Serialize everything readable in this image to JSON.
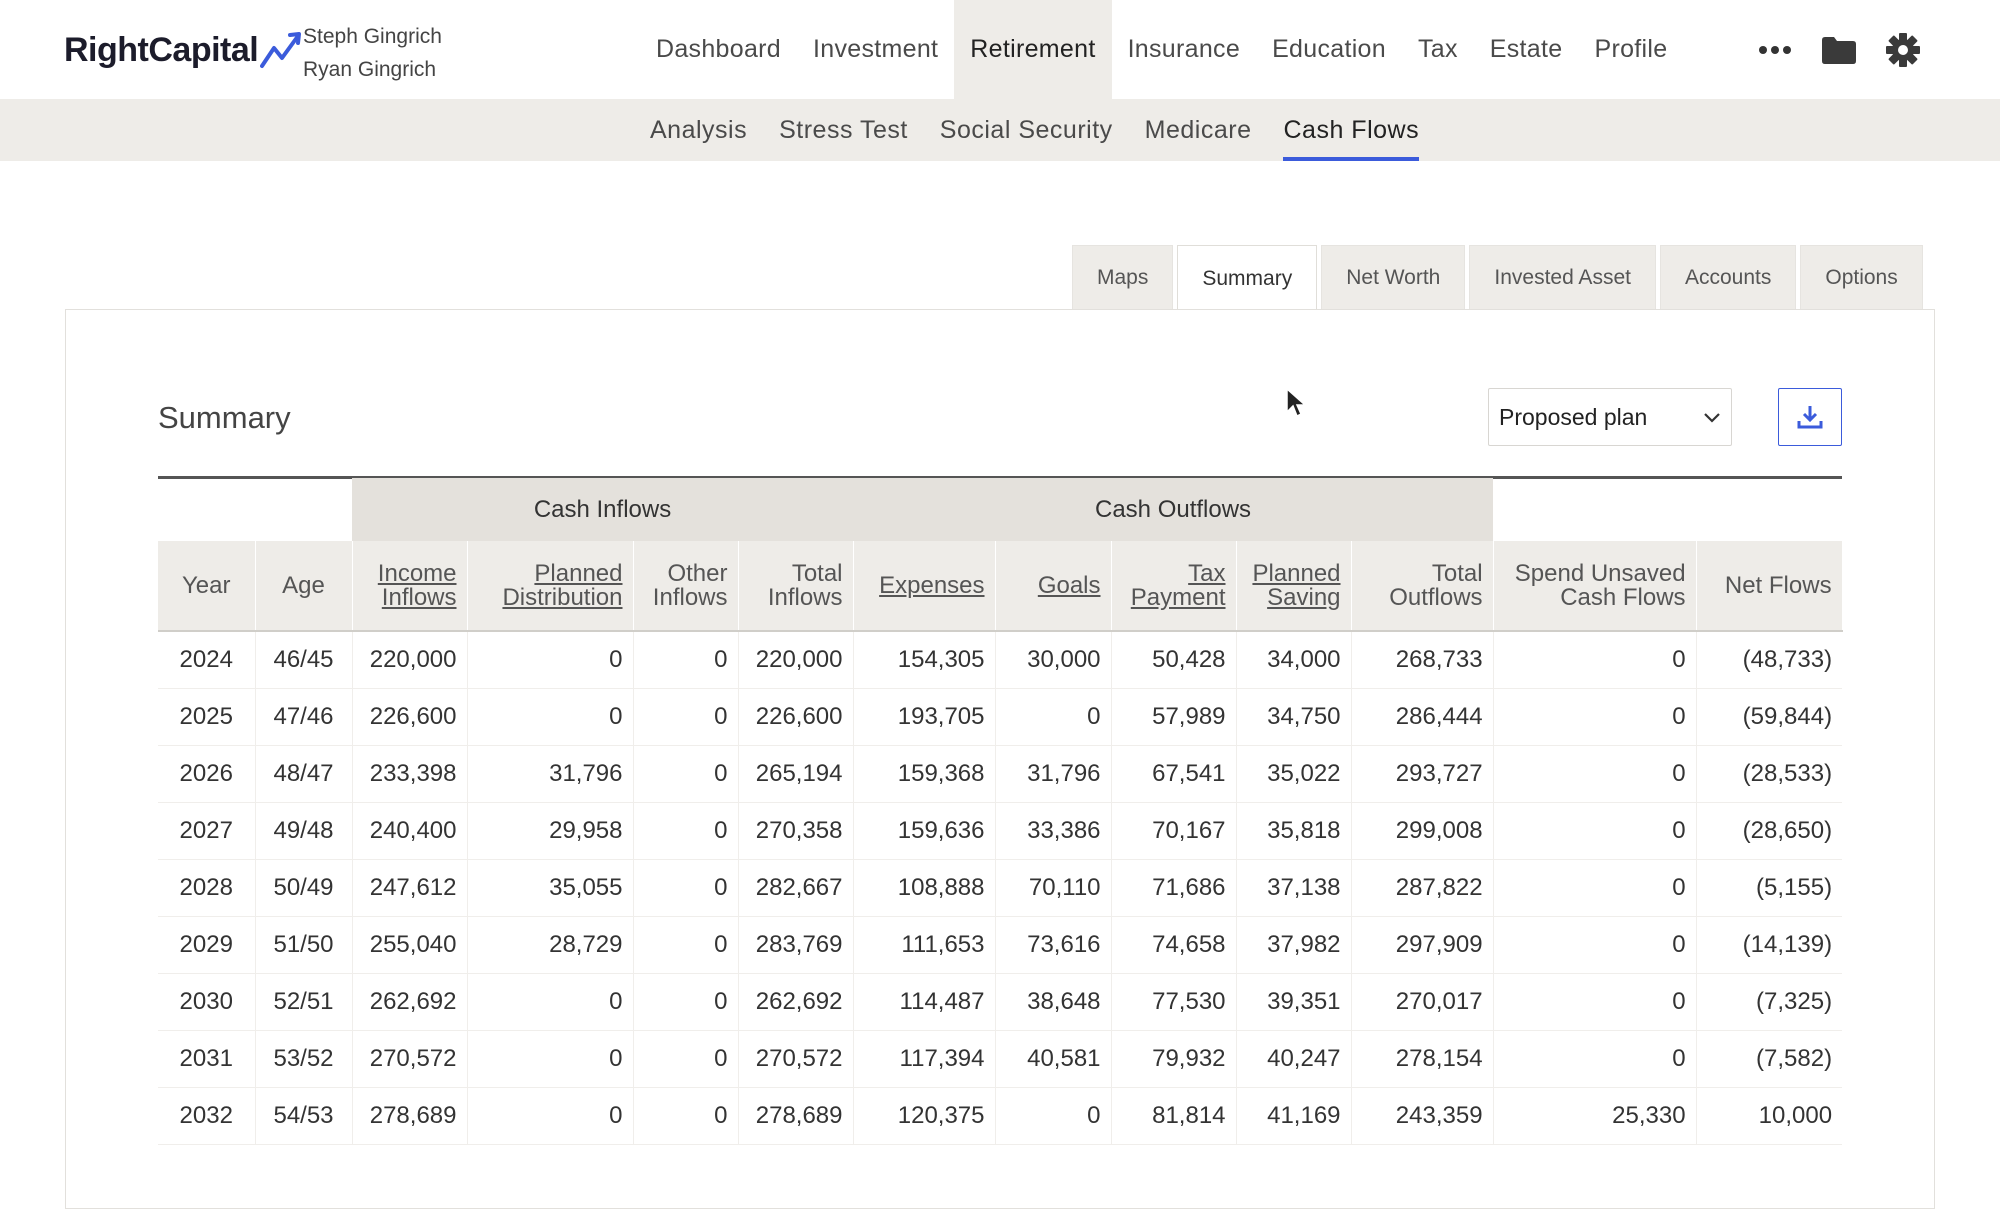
{
  "brand": {
    "name": "RightCapital"
  },
  "clients": [
    "Steph Gingrich",
    "Ryan Gingrich"
  ],
  "main_nav": [
    {
      "label": "Dashboard",
      "active": false
    },
    {
      "label": "Investment",
      "active": false
    },
    {
      "label": "Retirement",
      "active": true
    },
    {
      "label": "Insurance",
      "active": false
    },
    {
      "label": "Education",
      "active": false
    },
    {
      "label": "Tax",
      "active": false
    },
    {
      "label": "Estate",
      "active": false
    },
    {
      "label": "Profile",
      "active": false
    }
  ],
  "top_icons": [
    "more-icon",
    "folder-icon",
    "gear-icon"
  ],
  "sub_nav": [
    {
      "label": "Analysis",
      "active": false
    },
    {
      "label": "Stress Test",
      "active": false
    },
    {
      "label": "Social Security",
      "active": false
    },
    {
      "label": "Medicare",
      "active": false
    },
    {
      "label": "Cash Flows",
      "active": true
    }
  ],
  "tabs": [
    {
      "label": "Maps",
      "active": false
    },
    {
      "label": "Summary",
      "active": true
    },
    {
      "label": "Net Worth",
      "active": false
    },
    {
      "label": "Invested Asset",
      "active": false
    },
    {
      "label": "Accounts",
      "active": false
    },
    {
      "label": "Options",
      "active": false
    }
  ],
  "panel": {
    "title": "Summary",
    "plan_select": "Proposed plan"
  },
  "table": {
    "groups": {
      "inflows": "Cash Inflows",
      "outflows": "Cash Outflows"
    },
    "columns": [
      {
        "label": "Year",
        "link": false
      },
      {
        "label": "Age",
        "link": false
      },
      {
        "label": "Income Inflows",
        "link": true
      },
      {
        "label": "Planned Distribution",
        "link": true
      },
      {
        "label": "Other Inflows",
        "link": false
      },
      {
        "label": "Total Inflows",
        "link": false
      },
      {
        "label": "Expenses",
        "link": true
      },
      {
        "label": "Goals",
        "link": true
      },
      {
        "label": "Tax Payment",
        "link": true
      },
      {
        "label": "Planned Saving",
        "link": true
      },
      {
        "label": "Total Outflows",
        "link": false
      },
      {
        "label": "Spend Unsaved Cash Flows",
        "link": false
      },
      {
        "label": "Net Flows",
        "link": false
      }
    ],
    "rows": [
      [
        "2024",
        "46/45",
        "220,000",
        "0",
        "0",
        "220,000",
        "154,305",
        "30,000",
        "50,428",
        "34,000",
        "268,733",
        "0",
        "(48,733)"
      ],
      [
        "2025",
        "47/46",
        "226,600",
        "0",
        "0",
        "226,600",
        "193,705",
        "0",
        "57,989",
        "34,750",
        "286,444",
        "0",
        "(59,844)"
      ],
      [
        "2026",
        "48/47",
        "233,398",
        "31,796",
        "0",
        "265,194",
        "159,368",
        "31,796",
        "67,541",
        "35,022",
        "293,727",
        "0",
        "(28,533)"
      ],
      [
        "2027",
        "49/48",
        "240,400",
        "29,958",
        "0",
        "270,358",
        "159,636",
        "33,386",
        "70,167",
        "35,818",
        "299,008",
        "0",
        "(28,650)"
      ],
      [
        "2028",
        "50/49",
        "247,612",
        "35,055",
        "0",
        "282,667",
        "108,888",
        "70,110",
        "71,686",
        "37,138",
        "287,822",
        "0",
        "(5,155)"
      ],
      [
        "2029",
        "51/50",
        "255,040",
        "28,729",
        "0",
        "283,769",
        "111,653",
        "73,616",
        "74,658",
        "37,982",
        "297,909",
        "0",
        "(14,139)"
      ],
      [
        "2030",
        "52/51",
        "262,692",
        "0",
        "0",
        "262,692",
        "114,487",
        "38,648",
        "77,530",
        "39,351",
        "270,017",
        "0",
        "(7,325)"
      ],
      [
        "2031",
        "53/52",
        "270,572",
        "0",
        "0",
        "270,572",
        "117,394",
        "40,581",
        "79,932",
        "40,247",
        "278,154",
        "0",
        "(7,582)"
      ],
      [
        "2032",
        "54/53",
        "278,689",
        "0",
        "0",
        "278,689",
        "120,375",
        "0",
        "81,814",
        "41,169",
        "243,359",
        "25,330",
        "10,000"
      ]
    ]
  }
}
